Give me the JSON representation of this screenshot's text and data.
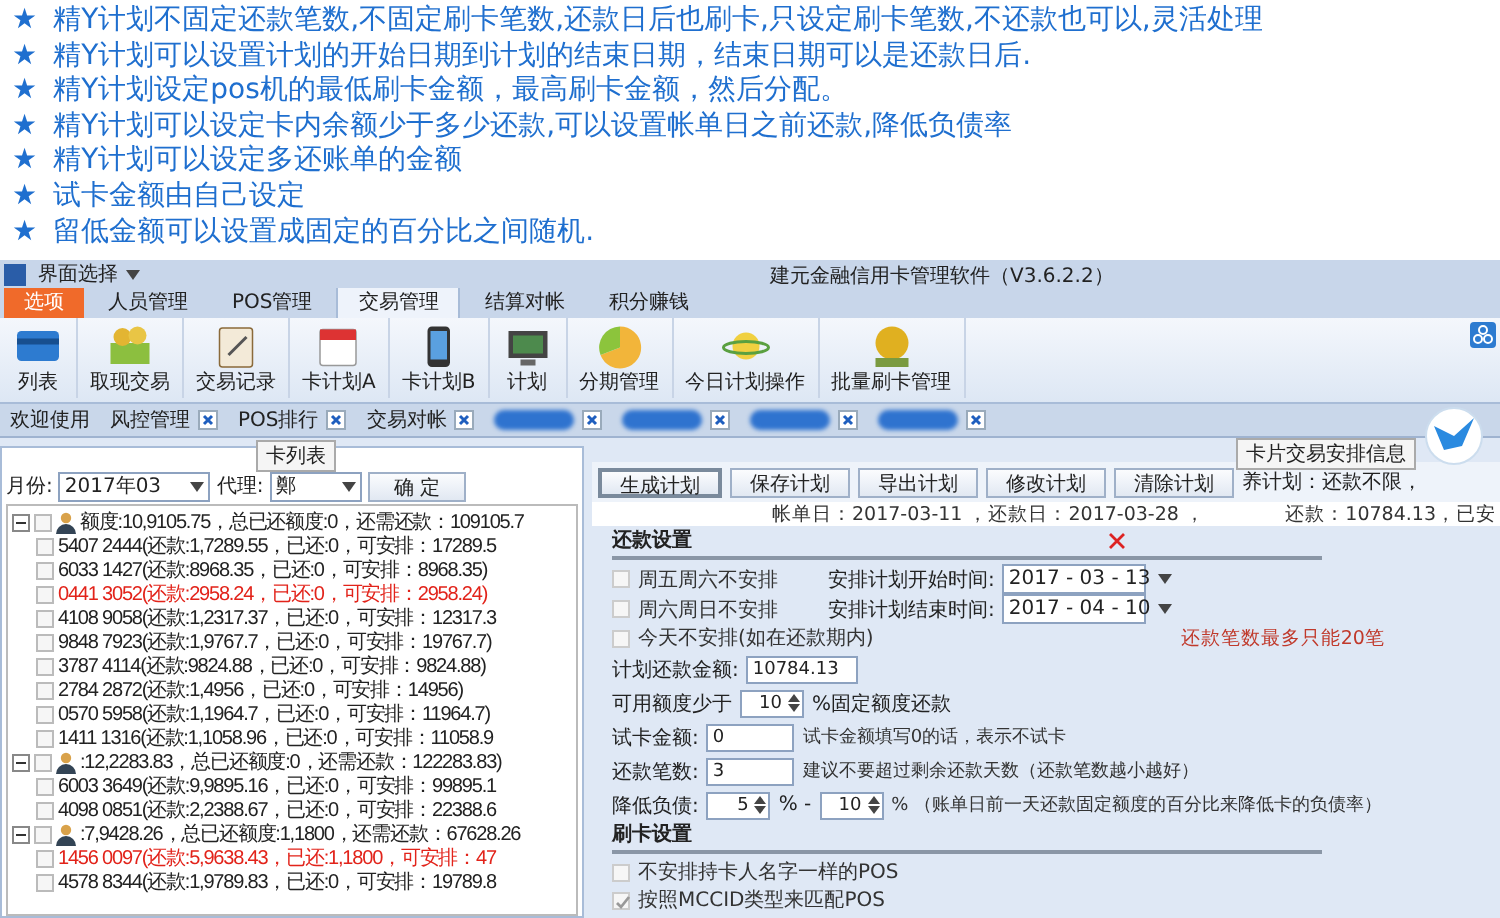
{
  "promo_lines": [
    "精Y计划不固定还款笔数,不固定刷卡笔数,还款日后也刷卡,只设定刷卡笔数,不还款也可以,灵活处理",
    "精Y计划可以设置计划的开始日期到计划的结束日期，结束日期可以是还款日后.",
    "精Y计划设定pos机的最低刷卡金额，最高刷卡金额，然后分配。",
    "精Y计划可以设定卡内余额少于多少还款,可以设置帐单日之前还款,降低负债率",
    "精Y计划可以设定多还账单的金额",
    "试卡金额由自己设定",
    "留低金额可以设置成固定的百分比之间随机."
  ],
  "promo_marker": "★",
  "window": {
    "menu": "界面选择",
    "title": "建元金融信用卡管理软件（V3.6.2.2）"
  },
  "ribbon_tabs": [
    {
      "label": "选项",
      "kind": "app"
    },
    {
      "label": "人员管理",
      "kind": "tab",
      "selected": false
    },
    {
      "label": "POS管理",
      "kind": "tab",
      "selected": false
    },
    {
      "label": "交易管理",
      "kind": "tab",
      "selected": true
    },
    {
      "label": "结算对帐",
      "kind": "tab",
      "selected": false
    },
    {
      "label": "积分赚钱",
      "kind": "tab",
      "selected": false
    }
  ],
  "toolbar": [
    {
      "label": "列表",
      "kind": "card"
    },
    {
      "label": "取现交易",
      "kind": "money"
    },
    {
      "label": "交易记录",
      "kind": "clipboard"
    },
    {
      "label": "卡计划A",
      "kind": "calendar"
    },
    {
      "label": "卡计划B",
      "kind": "phone"
    },
    {
      "label": "计划",
      "kind": "monitor"
    },
    {
      "label": "分期管理",
      "kind": "pie"
    },
    {
      "label": "今日计划操作",
      "kind": "orbit"
    },
    {
      "label": "批量刷卡管理",
      "kind": "coin"
    }
  ],
  "doc_tabs": [
    {
      "label": "欢迎使用",
      "closable": false
    },
    {
      "label": "风控管理",
      "closable": true
    },
    {
      "label": "POS排行",
      "closable": true
    },
    {
      "label": "交易对帐",
      "closable": true
    },
    {
      "closable": true
    },
    {
      "closable": true
    },
    {
      "closable": true
    },
    {
      "closable": true
    }
  ],
  "card_list": {
    "title": "卡列表",
    "month_label": "月份:",
    "month_value": "2017年03",
    "agent_label": "代理:",
    "agent_value": "鄭",
    "confirm": "确 定",
    "groups": [
      {
        "text": "额度:10,9105.75，总已还额度:0，还需还款：109105.7",
        "expanded": true,
        "checked": false,
        "children": [
          {
            "text": "5407 2444(还款:1,7289.55，已还:0，可安排：17289.5",
            "alert": false,
            "checked": false
          },
          {
            "text": "6033 1427(还款:8968.35，已还:0，可安排：8968.35)",
            "alert": false,
            "checked": false
          },
          {
            "text": "0441 3052(还款:2958.24，已还:0，可安排：2958.24)",
            "alert": true,
            "checked": false
          },
          {
            "text": "4108 9058(还款:1,2317.37，已还:0，可安排：12317.3",
            "alert": false,
            "checked": false
          },
          {
            "text": "9848 7923(还款:1,9767.7，已还:0，可安排：19767.7)",
            "alert": false,
            "checked": false
          },
          {
            "text": "3787 4114(还款:9824.88，已还:0，可安排：9824.88)",
            "alert": false,
            "checked": false
          },
          {
            "text": "2784 2872(还款:1,4956，已还:0，可安排：14956)",
            "alert": false,
            "checked": false
          },
          {
            "text": "0570 5958(还款:1,1964.7，已还:0，可安排：11964.7)",
            "alert": false,
            "checked": false
          },
          {
            "text": "1411 1316(还款:1,1058.96，已还:0，可安排：11058.9",
            "alert": false,
            "checked": false
          }
        ]
      },
      {
        "text": ":12,2283.83，总已还额度:0，还需还款：122283.83)",
        "expanded": true,
        "checked": false,
        "children": [
          {
            "text": "6003 3649(还款:9,9895.16，已还:0，可安排：99895.1",
            "alert": false,
            "checked": false
          },
          {
            "text": "4098 0851(还款:2,2388.67，已还:0，可安排：22388.6",
            "alert": false,
            "checked": false
          }
        ]
      },
      {
        "text": ":7,9428.26，总已还额度:1,1800，还需还款：67628.26",
        "expanded": true,
        "checked": false,
        "children": [
          {
            "text": "1456 0097(还款:5,9638.43，已还:1,1800，可安排：47",
            "alert": true,
            "checked": false
          },
          {
            "text": "4578 8344(还款:1,9789.83，已还:0，可安排：19789.8",
            "alert": false,
            "checked": false
          }
        ]
      }
    ]
  },
  "plan": {
    "title": "卡片交易安排信息",
    "buttons": [
      {
        "label": "生成计划",
        "selected": true
      },
      {
        "label": "保存计划",
        "selected": false
      },
      {
        "label": "导出计划",
        "selected": false
      },
      {
        "label": "修改计划",
        "selected": false
      },
      {
        "label": "清除计划",
        "selected": false
      }
    ],
    "status": "养计划：还款不限，",
    "info_left": "帐单日：2017-03-11 ，还款日：2017-03-28 ，",
    "info_right": "还款：10784.13，已安",
    "repay_section": "还款设置",
    "options": [
      {
        "label": "周五周六不安排",
        "checked": false,
        "field_label": "安排计划开始时间:",
        "field_value": "2017 - 03 - 13"
      },
      {
        "label": "周六周日不安排",
        "checked": false,
        "field_label": "安排计划结束时间:",
        "field_value": "2017 - 04 - 10"
      },
      {
        "label": "今天不安排(如在还款期内)",
        "checked": false,
        "note": "还款笔数最多只能20笔"
      }
    ],
    "amount_label": "计划还款金额:",
    "amount_value": "10784.13",
    "threshold_label": "可用额度少于",
    "threshold_value": "10",
    "threshold_suffix": "%固定额度还款",
    "trial_label": "试卡金额:",
    "trial_value": "0",
    "trial_hint": "试卡金额填写0的话，表示不试卡",
    "count_label": "还款笔数:",
    "count_value": "3",
    "count_hint": "建议不要超过剩余还款天数（还款笔数越小越好）",
    "debt_label": "降低负债:",
    "debt_min": "5",
    "debt_sep": "% -",
    "debt_max": "10",
    "debt_hint": "% （账单日前一天还款固定额度的百分比来降低卡的负债率）",
    "swipe_section": "刷卡设置",
    "swipe_options": [
      {
        "label": "不安排持卡人名字一样的POS",
        "checked": false
      },
      {
        "label": "按照MCCID类型来匹配POS",
        "checked": true
      }
    ]
  }
}
